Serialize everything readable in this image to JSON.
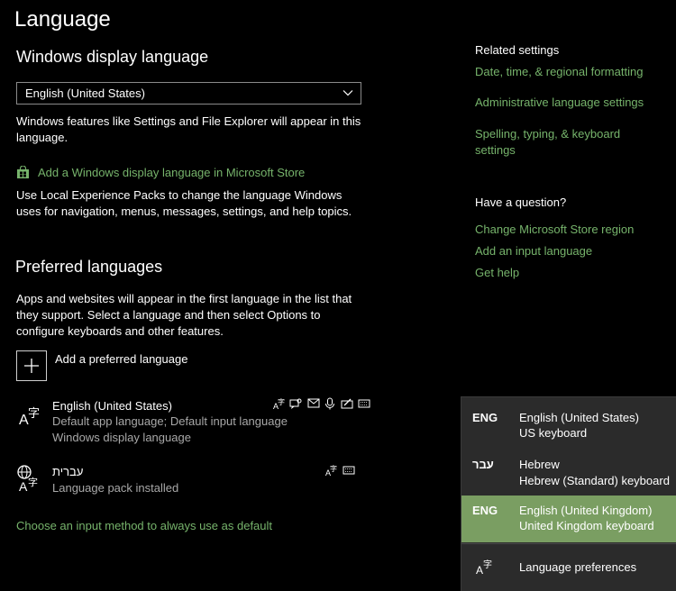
{
  "page_title": "Language",
  "display_language": {
    "heading": "Windows display language",
    "selected": "English (United States)",
    "description": "Windows features like Settings and File Explorer will appear in this language.",
    "add_link": "Add a Windows display language in Microsoft Store",
    "lxp_text": "Use Local Experience Packs to change the language Windows uses for navigation, menus, messages, settings, and help topics."
  },
  "preferred": {
    "heading": "Preferred languages",
    "description": "Apps and websites will appear in the first language in the list that they support. Select a language and then select Options to configure keyboards and other features.",
    "add_label": "Add a preferred language",
    "languages": [
      {
        "name": "English (United States)",
        "sub1": "Default app language; Default input language",
        "sub2": "Windows display language"
      },
      {
        "name": "עברית",
        "sub1": "Language pack installed"
      }
    ],
    "input_method_link": "Choose an input method to always use as default"
  },
  "related": {
    "heading": "Related settings",
    "links": [
      "Date, time, & regional formatting",
      "Administrative language settings",
      "Spelling, typing, & keyboard settings"
    ]
  },
  "question": {
    "heading": "Have a question?",
    "links": [
      "Change Microsoft Store region",
      "Add an input language",
      "Get help"
    ]
  },
  "flyout": {
    "items": [
      {
        "code": "ENG",
        "line1": "English (United States)",
        "line2": "US keyboard",
        "selected": false
      },
      {
        "code": "עבר",
        "line1": "Hebrew",
        "line2": "Hebrew (Standard) keyboard",
        "selected": false
      },
      {
        "code": "ENG",
        "line1": "English (United Kingdom)",
        "line2": "United Kingdom keyboard",
        "selected": true
      }
    ],
    "prefs_label": "Language preferences"
  },
  "colors": {
    "accent_link": "#76b36b",
    "selected_row": "#7a9e62",
    "flyout_bg": "#2b2b2b"
  }
}
